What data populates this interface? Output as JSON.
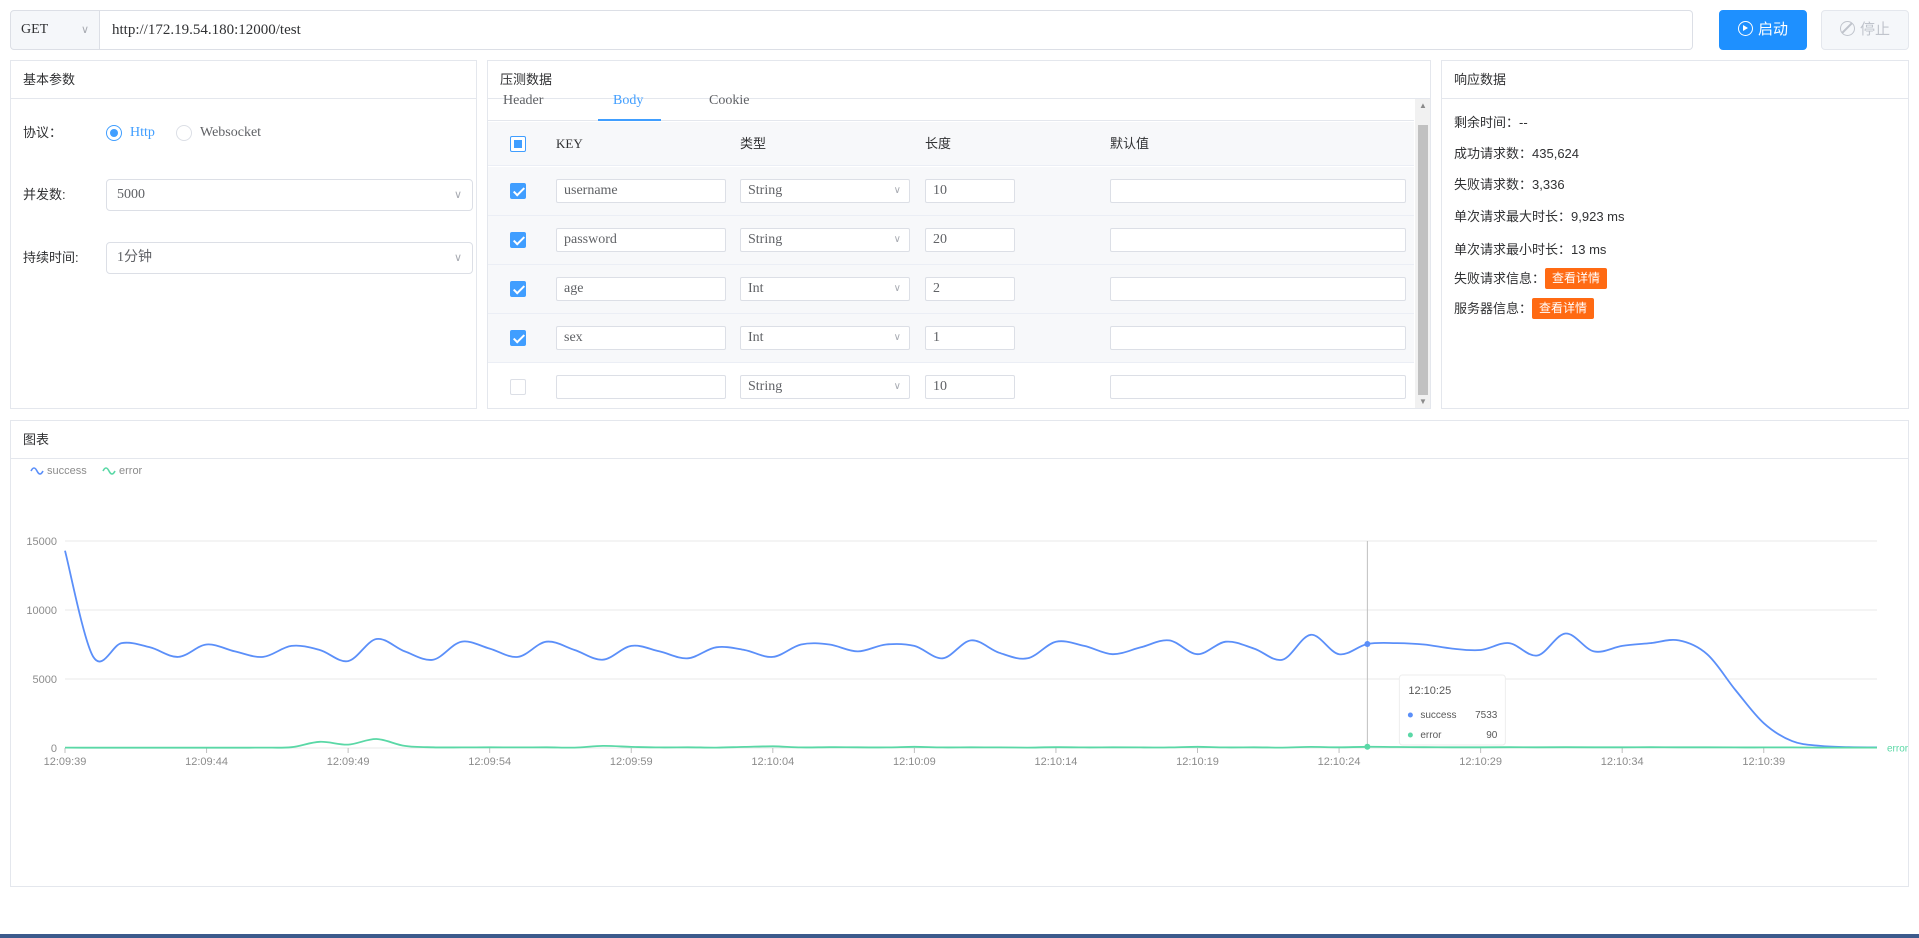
{
  "toolbar": {
    "method": "GET",
    "url": "http://172.19.54.180:12000/test",
    "start_label": "启动",
    "stop_label": "停止"
  },
  "basic": {
    "title": "基本参数",
    "protocol_label": "协议：",
    "protocol_options": [
      "Http",
      "Websocket"
    ],
    "protocol_selected": "Http",
    "concurrency_label": "并发数:",
    "concurrency_value": "5000",
    "duration_label": "持续时间:",
    "duration_value": "1分钟"
  },
  "testdata": {
    "title": "压测数据",
    "tabs": [
      "Header",
      "Body",
      "Cookie"
    ],
    "active_tab": "Body",
    "columns": [
      "KEY",
      "类型",
      "长度",
      "默认值"
    ],
    "rows": [
      {
        "checked": true,
        "key": "username",
        "type": "String",
        "length": "10",
        "default": ""
      },
      {
        "checked": true,
        "key": "password",
        "type": "String",
        "length": "20",
        "default": ""
      },
      {
        "checked": true,
        "key": "age",
        "type": "Int",
        "length": "2",
        "default": ""
      },
      {
        "checked": true,
        "key": "sex",
        "type": "Int",
        "length": "1",
        "default": ""
      },
      {
        "checked": false,
        "key": "",
        "type": "String",
        "length": "10",
        "default": ""
      }
    ]
  },
  "response": {
    "title": "响应数据",
    "remaining_label": "剩余时间：",
    "remaining_value": "--",
    "success_label": "成功请求数：",
    "success_value": "435,624",
    "fail_label": "失败请求数：",
    "fail_value": "3,336",
    "max_label": "单次请求最大时长：",
    "max_value": "9,923 ms",
    "min_label": "单次请求最小时长：",
    "min_value": "13 ms",
    "fail_info_label": "失败请求信息：",
    "server_info_label": "服务器信息：",
    "detail_button": "查看详情"
  },
  "chart_panel": {
    "title": "图表"
  },
  "chart_data": {
    "type": "line",
    "x": [
      "12:09:39",
      "12:09:40",
      "12:09:41",
      "12:09:42",
      "12:09:43",
      "12:09:44",
      "12:09:45",
      "12:09:46",
      "12:09:47",
      "12:09:48",
      "12:09:49",
      "12:09:50",
      "12:09:51",
      "12:09:52",
      "12:09:53",
      "12:09:54",
      "12:09:55",
      "12:09:56",
      "12:09:57",
      "12:09:58",
      "12:09:59",
      "12:10:00",
      "12:10:01",
      "12:10:02",
      "12:10:03",
      "12:10:04",
      "12:10:05",
      "12:10:06",
      "12:10:07",
      "12:10:08",
      "12:10:09",
      "12:10:10",
      "12:10:11",
      "12:10:12",
      "12:10:13",
      "12:10:14",
      "12:10:15",
      "12:10:16",
      "12:10:17",
      "12:10:18",
      "12:10:19",
      "12:10:20",
      "12:10:21",
      "12:10:22",
      "12:10:23",
      "12:10:24",
      "12:10:25",
      "12:10:26",
      "12:10:27",
      "12:10:28",
      "12:10:29",
      "12:10:30",
      "12:10:31",
      "12:10:32",
      "12:10:33",
      "12:10:34",
      "12:10:35",
      "12:10:36",
      "12:10:37",
      "12:10:38",
      "12:10:39",
      "12:10:40",
      "12:10:41",
      "12:10:42",
      "12:10:43"
    ],
    "x_ticks": [
      "12:09:39",
      "12:09:44",
      "12:09:49",
      "12:09:54",
      "12:09:59",
      "12:10:04",
      "12:10:09",
      "12:10:14",
      "12:10:19",
      "12:10:24",
      "12:10:29",
      "12:10:34",
      "12:10:39"
    ],
    "series": [
      {
        "name": "success",
        "color": "#5b8ff9",
        "values": [
          14300,
          6600,
          7600,
          7300,
          6600,
          7500,
          7000,
          6600,
          7400,
          7100,
          6300,
          7900,
          7000,
          6400,
          7700,
          7200,
          6600,
          7700,
          7100,
          6400,
          7400,
          7000,
          6500,
          7300,
          7100,
          6600,
          7500,
          7500,
          7000,
          7500,
          7400,
          6500,
          7800,
          6900,
          6500,
          7700,
          7400,
          6800,
          7300,
          7800,
          6800,
          7700,
          7200,
          6400,
          8200,
          6800,
          7533,
          7600,
          7500,
          7200,
          7100,
          7600,
          6700,
          8300,
          7000,
          7400,
          7600,
          7800,
          6800,
          4200,
          1800,
          500,
          150,
          60,
          40
        ]
      },
      {
        "name": "error",
        "color": "#5ad8a6",
        "values": [
          30,
          20,
          20,
          20,
          20,
          20,
          20,
          30,
          60,
          450,
          250,
          650,
          150,
          50,
          40,
          50,
          40,
          50,
          30,
          150,
          80,
          40,
          50,
          30,
          80,
          120,
          40,
          60,
          50,
          40,
          90,
          40,
          50,
          40,
          30,
          60,
          40,
          50,
          40,
          40,
          90,
          40,
          50,
          30,
          80,
          50,
          90,
          70,
          60,
          50,
          50,
          60,
          50,
          60,
          50,
          50,
          60,
          50,
          50,
          40,
          40,
          40,
          30,
          30,
          30
        ]
      }
    ],
    "ylim": [
      0,
      15000
    ],
    "y_ticks": [
      0,
      5000,
      10000,
      15000
    ],
    "legend": "top-left",
    "tooltip": {
      "time": "12:10:25",
      "success": "7533",
      "error": "90"
    },
    "grid": true
  }
}
